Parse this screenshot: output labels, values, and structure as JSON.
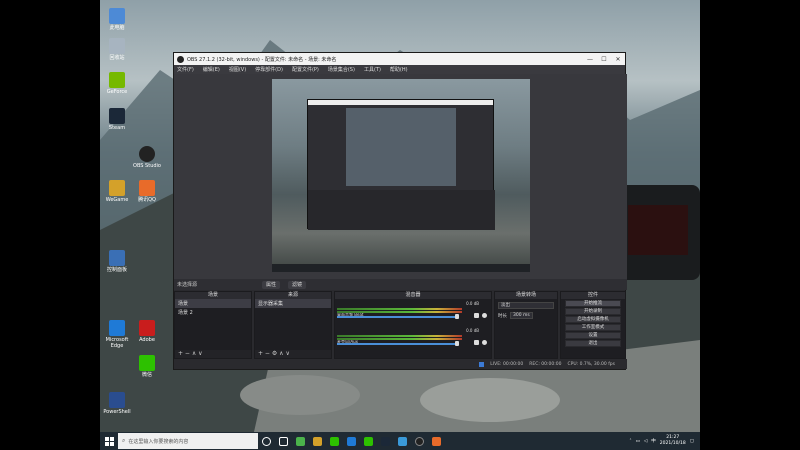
{
  "obs": {
    "title": "OBS 27.1.2 (32-bit, windows) - 配置文件: 未命名 - 场景: 未命名",
    "window_buttons": {
      "minimize": "—",
      "maximize": "☐",
      "close": "✕"
    },
    "menu": [
      "文件(F)",
      "编辑(E)",
      "视图(V)",
      "停靠部件(D)",
      "配置文件(P)",
      "场景集合(S)",
      "工具(T)",
      "帮助(H)"
    ],
    "no_source_label": "未选择源",
    "mid_buttons": [
      "属性",
      "滤镜"
    ],
    "docks": {
      "scenes": {
        "header": "场景",
        "items": [
          "场景",
          "场景 2"
        ],
        "footer": "+ − ∧ ∨"
      },
      "sources": {
        "header": "来源",
        "items": [
          "显示器采集"
        ],
        "footer": "+ − ⚙ ∧ ∨"
      },
      "mixer": {
        "header": "混音器",
        "channels": [
          {
            "name": "桌面音频 Beat",
            "db": "0.0 dB"
          },
          {
            "name": "麦克风/Aux",
            "db": "0.0 dB"
          }
        ]
      },
      "transitions": {
        "header": "场景转场",
        "type": "淡出",
        "duration_label": "时长",
        "duration_value": "300 ms"
      },
      "controls": {
        "header": "控件",
        "buttons": [
          "开始推流",
          "开始录制",
          "启动虚拟摄像机",
          "工作室模式",
          "设置",
          "退出"
        ]
      }
    },
    "status": {
      "live": "LIVE: 00:00:00",
      "rec": "REC: 00:00:00",
      "cpu": "CPU: 0.7%, 30.00 fps"
    }
  },
  "desktop_icons": [
    "此电脑",
    "回收站",
    "GeForce",
    "Steam",
    "OBS Studio",
    "WeGame",
    "腾讯QQ",
    "控制面板",
    "Microsoft Edge",
    "Adobe",
    "微信",
    "PowerShell"
  ],
  "taskbar": {
    "search_placeholder": "在这里输入你要搜索的内容",
    "time": "21:27",
    "date": "2021/10/18",
    "lang": "中"
  }
}
